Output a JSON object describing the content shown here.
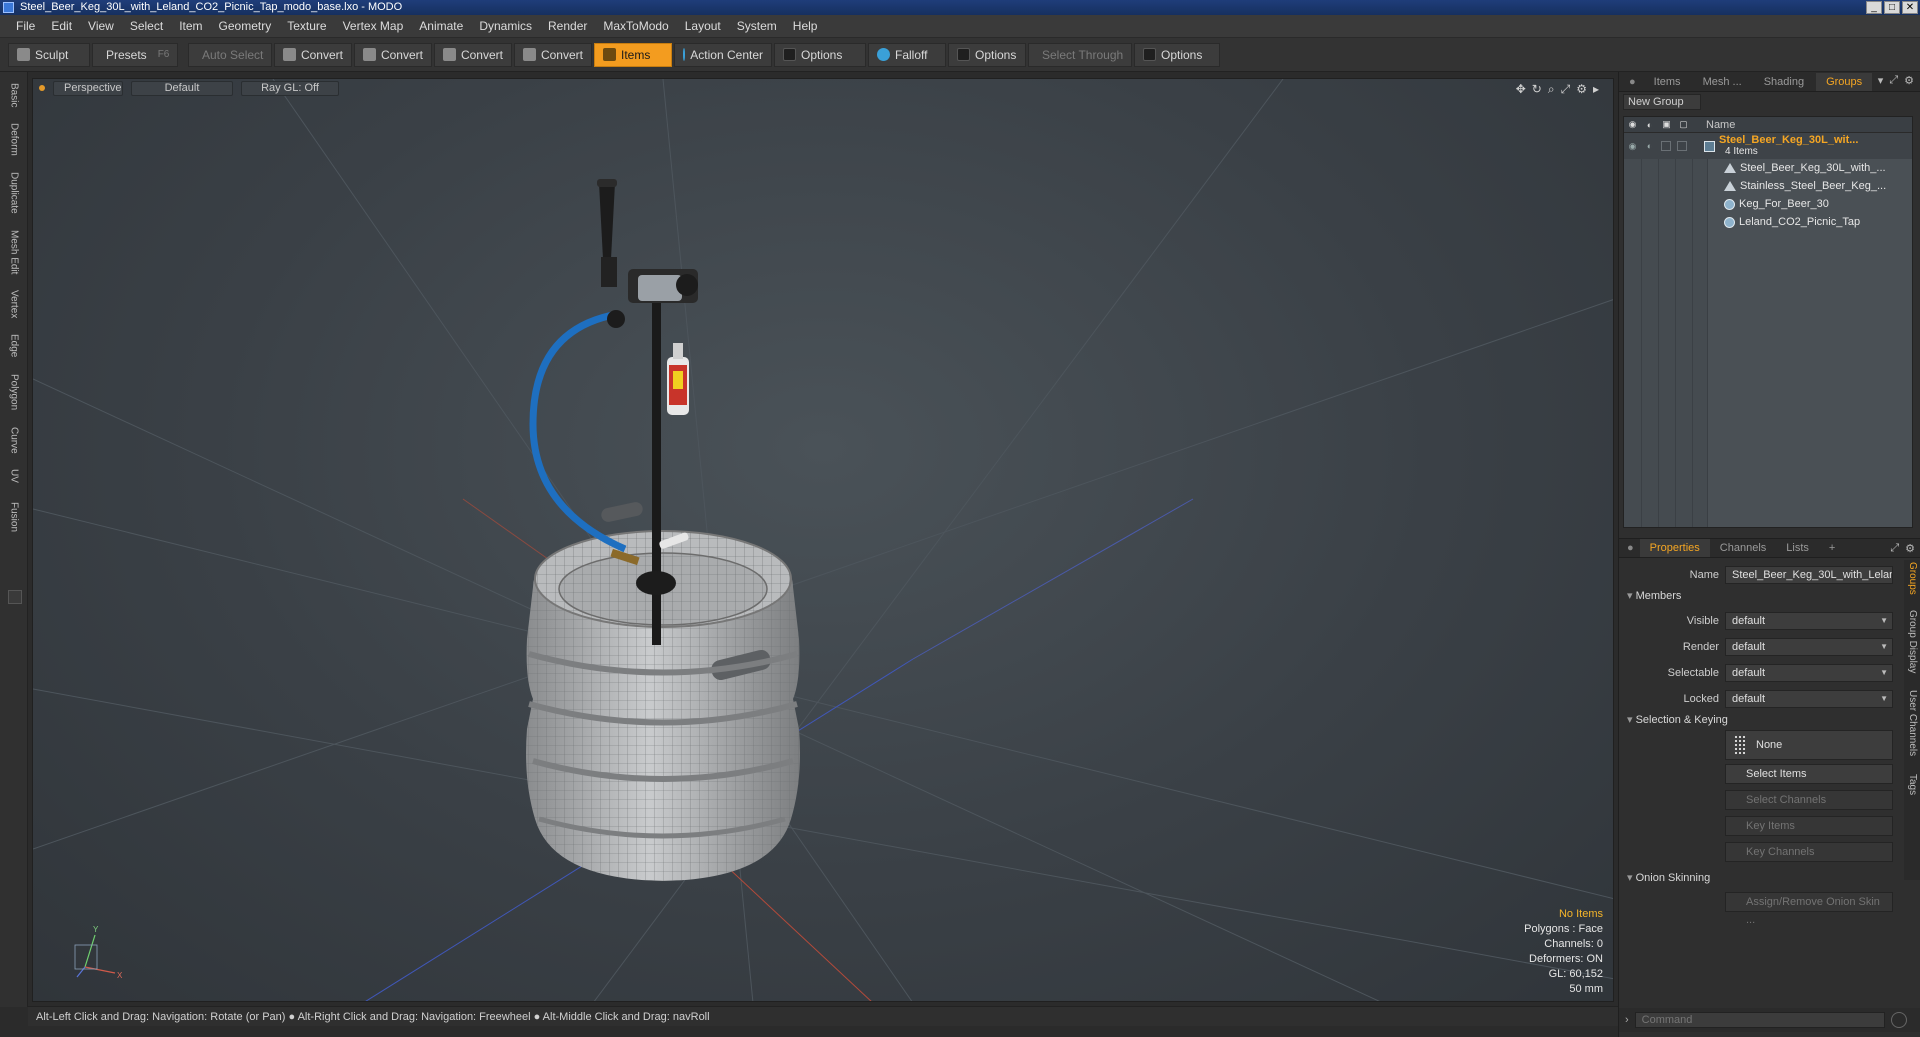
{
  "window": {
    "title": "Steel_Beer_Keg_30L_with_Leland_CO2_Picnic_Tap_modo_base.lxo - MODO",
    "buttons": [
      "_",
      "□",
      "✕"
    ]
  },
  "menu": [
    "File",
    "Edit",
    "View",
    "Select",
    "Item",
    "Geometry",
    "Texture",
    "Vertex Map",
    "Animate",
    "Dynamics",
    "Render",
    "MaxToModo",
    "Layout",
    "System",
    "Help"
  ],
  "toolbar": {
    "sculpt": "Sculpt",
    "presets": "Presets",
    "presets_key": "F6",
    "auto_select": "Auto Select",
    "convert1": "Convert",
    "convert2": "Convert",
    "convert3": "Convert",
    "convert4": "Convert",
    "items": "Items",
    "action_center": "Action Center",
    "options1": "Options",
    "falloff": "Falloff",
    "options2": "Options",
    "select_through": "Select Through",
    "options3": "Options"
  },
  "left_tabs": [
    "Basic",
    "Deform",
    "Duplicate",
    "Mesh Edit",
    "Vertex",
    "Edge",
    "Polygon",
    "Curve",
    "UV",
    "Fusion"
  ],
  "viewport": {
    "view": "Perspective",
    "shading": "Default",
    "raygl": "Ray GL: Off",
    "stats": {
      "selection": "No Items",
      "polygons": "Polygons : Face",
      "channels": "Channels: 0",
      "deformers": "Deformers: ON",
      "gl": "GL: 60,152",
      "focal": "50 mm"
    },
    "axis_y": "Y",
    "axis_x": "X"
  },
  "status": "Alt-Left Click and Drag: Navigation: Rotate (or Pan) ● Alt-Right Click and Drag: Navigation: Freewheel ● Alt-Middle Click and Drag: navRoll",
  "groups_panel": {
    "tabs": [
      "Items",
      "Mesh ...",
      "Shading",
      "Groups"
    ],
    "active_tab": "Groups",
    "new_group": "New Group",
    "column_name": "Name",
    "group_name": "Steel_Beer_Keg_30L_wit...",
    "group_count": "4 Items",
    "children": [
      "Steel_Beer_Keg_30L_with_...",
      "Stainless_Steel_Beer_Keg_...",
      "Keg_For_Beer_30",
      "Leland_CO2_Picnic_Tap"
    ]
  },
  "properties": {
    "tabs": [
      "Properties",
      "Channels",
      "Lists",
      "+"
    ],
    "name_label": "Name",
    "name_value": "Steel_Beer_Keg_30L_with_Lelan",
    "members": "Members",
    "visible_label": "Visible",
    "visible_value": "default",
    "render_label": "Render",
    "render_value": "default",
    "selectable_label": "Selectable",
    "selectable_value": "default",
    "locked_label": "Locked",
    "locked_value": "default",
    "selection_keying": "Selection & Keying",
    "none": "None",
    "select_items": "Select Items",
    "select_channels": "Select Channels",
    "key_items": "Key Items",
    "key_channels": "Key Channels",
    "onion": "Onion Skinning",
    "assign_onion": "Assign/Remove Onion Skin ..."
  },
  "right_vtabs": [
    "Groups",
    "Group Display",
    "User Channels",
    "Tags"
  ],
  "command_placeholder": "Command",
  "colors": {
    "accent": "#f5a623",
    "hose": "#1e6fc0"
  }
}
